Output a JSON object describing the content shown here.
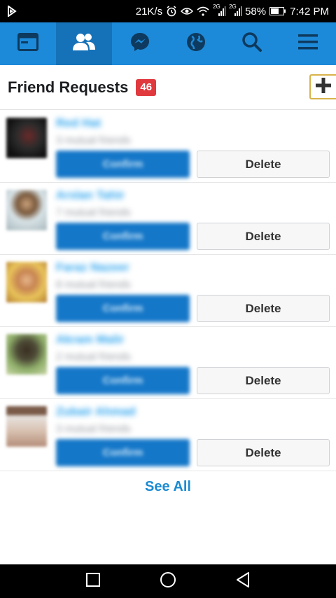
{
  "status_bar": {
    "speed": "21K/s",
    "net1": "2G",
    "net2": "2G",
    "battery": "58%",
    "time": "7:42 PM"
  },
  "nav": {
    "items": [
      {
        "icon": "news-feed-icon"
      },
      {
        "icon": "friends-icon",
        "active": true
      },
      {
        "icon": "messenger-icon"
      },
      {
        "icon": "globe-icon"
      },
      {
        "icon": "search-icon"
      },
      {
        "icon": "menu-icon"
      }
    ]
  },
  "header": {
    "title": "Friend Requests",
    "count": "46"
  },
  "requests": [
    {
      "name": "Red Hat",
      "mutual": "3 mutual friends",
      "confirm": "Confirm",
      "delete": "Delete"
    },
    {
      "name": "Arslan Tahir",
      "mutual": "7 mutual friends",
      "confirm": "Confirm",
      "delete": "Delete"
    },
    {
      "name": "Faraz Nazeer",
      "mutual": "8 mutual friends",
      "confirm": "Confirm",
      "delete": "Delete"
    },
    {
      "name": "Akram Malir",
      "mutual": "2 mutual friends",
      "confirm": "Confirm",
      "delete": "Delete"
    },
    {
      "name": "Zubair Ahmad",
      "mutual": "3 mutual friends",
      "confirm": "Confirm",
      "delete": "Delete"
    }
  ],
  "see_all": "See All",
  "colors": {
    "brand_blue": "#1d8ad9",
    "confirm_blue": "#1577c8",
    "badge_red": "#e0393e"
  }
}
